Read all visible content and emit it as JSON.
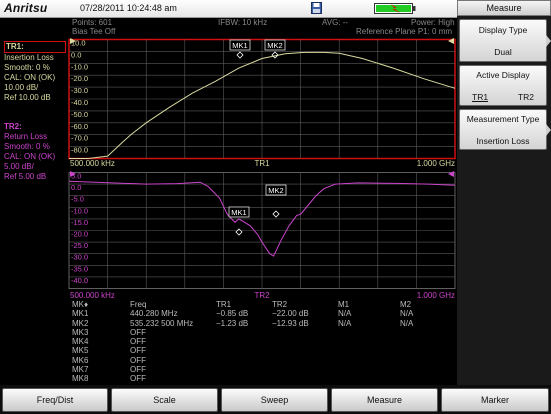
{
  "statusbar": {
    "brand": "Anritsu",
    "datetime": "07/28/2011 10:24:48 am"
  },
  "info": {
    "points": "Points: 601",
    "bias": "Bias Tee Off",
    "ifbw": "IFBW: 10 kHz",
    "avg": "AVG: --",
    "power": "Power: High",
    "ref_plane": "Reference Plane P1: 0 mm"
  },
  "tr1": {
    "title": "TR1:",
    "lines": [
      "Insertion Loss",
      "Smooth: 0 %",
      "CAL: ON (OK)",
      "10.00 dB/",
      "Ref 10.00 dB"
    ],
    "ticks": [
      "10.0",
      "0.0",
      "-10.0",
      "-20.0",
      "-30.0",
      "-40.0",
      "-50.0",
      "-60.0",
      "-70.0",
      "-80.0"
    ],
    "x_start": "500.000 kHz",
    "x_label": "TR1",
    "x_stop": "1.000 GHz",
    "mk1": "MK1",
    "mk2": "MK2"
  },
  "tr2": {
    "title": "TR2:",
    "lines": [
      "Return Loss",
      "Smooth: 0 %",
      "CAL: ON (OK)",
      "5.00 dB/",
      "Ref 5.00 dB"
    ],
    "ticks": [
      "5.0",
      "0.0",
      "-5.0",
      "-10.0",
      "-15.0",
      "-20.0",
      "-25.0",
      "-30.0",
      "-35.0",
      "-40.0"
    ],
    "x_start": "500.000 kHz",
    "x_label": "TR2",
    "x_stop": "1.000 GHz",
    "mk1": "MK1",
    "mk2": "MK2"
  },
  "markers": {
    "headers": [
      "MK♦",
      "Freq",
      "TR1",
      "TR2",
      "M1",
      "M2"
    ],
    "rows": [
      [
        "MK1",
        "440.280 MHz",
        "−0.85 dB",
        "−22.00 dB",
        "N/A",
        "N/A"
      ],
      [
        "MK2",
        "535.232 500 MHz",
        "−1.23 dB",
        "−12.93 dB",
        "N/A",
        "N/A"
      ],
      [
        "MK3",
        "OFF",
        "",
        "",
        "",
        ""
      ],
      [
        "MK4",
        "OFF",
        "",
        "",
        "",
        ""
      ],
      [
        "MK5",
        "OFF",
        "",
        "",
        "",
        ""
      ],
      [
        "MK6",
        "OFF",
        "",
        "",
        "",
        ""
      ],
      [
        "MK7",
        "OFF",
        "",
        "",
        "",
        ""
      ],
      [
        "MK8",
        "OFF",
        "",
        "",
        "",
        ""
      ]
    ]
  },
  "menu": {
    "title": "Measure",
    "display_type_label": "Display Type",
    "display_type_value": "Dual",
    "active_display_label": "Active Display",
    "active_tr1": "TR1",
    "active_tr2": "TR2",
    "measurement_type_label": "Measurement Type",
    "measurement_type_value": "Insertion Loss"
  },
  "bottom": [
    "Freq/Dist",
    "Scale",
    "Sweep",
    "Measure",
    "Marker"
  ],
  "colors": {
    "tr1": "#d9d9a0",
    "tr2": "#cc44cc",
    "active_frame": "#d01010",
    "battery": "#22cc22"
  }
}
